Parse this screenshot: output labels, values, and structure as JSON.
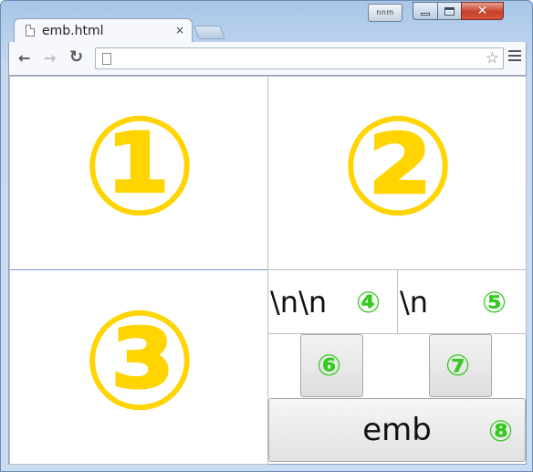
{
  "window": {
    "user_badge": "nnm",
    "controls": {
      "minimize": "minimize",
      "maximize": "maximize",
      "close": "close"
    }
  },
  "tab": {
    "title": "emb.html",
    "close": "×"
  },
  "toolbar": {
    "back": "←",
    "forward": "→",
    "reload": "↻",
    "address_value": "",
    "star": "☆"
  },
  "frames": {
    "frame1": "①",
    "frame2": "②",
    "frame3": "③"
  },
  "textareas": {
    "ta4_value": "\\n\\n",
    "ta4_marker": "④",
    "ta5_value": "\\n",
    "ta5_marker": "⑤"
  },
  "buttons": {
    "btn6_marker": "⑥",
    "btn7_marker": "⑦",
    "emb_label": "emb",
    "emb_marker": "⑧"
  },
  "colors": {
    "frame_number": "#ffd400",
    "marker": "#35c81f"
  }
}
